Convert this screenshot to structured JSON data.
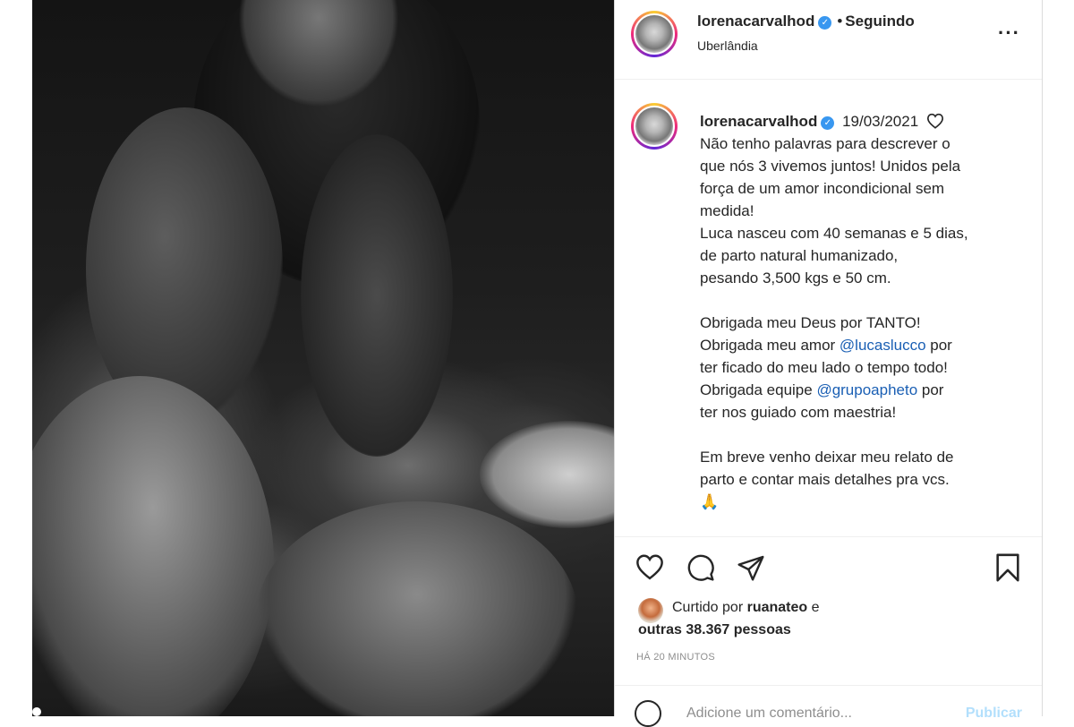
{
  "post": {
    "username": "lorenacarvalhod",
    "follow_status": "Seguindo",
    "location": "Uberlândia",
    "more_icon": "more-options-icon",
    "caption": {
      "username": "lorenacarvalhod",
      "date": "19/03/2021",
      "lines": [
        "Não tenho palavras para descrever o",
        "que nós 3 vivemos juntos! Unidos pela",
        "força de um amor incondicional sem",
        "medida!",
        "Luca nasceu com 40 semanas e 5 dias,",
        "de parto natural humanizado,",
        "pesando 3,500 kgs e 50 cm."
      ],
      "thanks1": "Obrigada meu Deus por TANTO!",
      "thanks2_pre": "Obrigada meu amor ",
      "mention1": "@lucaslucco",
      "thanks2_post": " por",
      "thanks3": "ter ficado do meu lado o tempo todo!",
      "thanks4_pre": "Obrigada equipe ",
      "mention2": "@grupoapheto",
      "thanks4_post": " por",
      "thanks5": "ter nos guiado com maestria!",
      "closing1": "Em breve venho deixar meu relato de",
      "closing2": "parto e contar mais detalhes pra vcs.",
      "emoji": "🙏"
    },
    "likes": {
      "prefix": "Curtido por ",
      "user": "ruanateo",
      "mid": " e",
      "others": "outras 38.367 pessoas"
    },
    "time_ago": "HÁ 20 MINUTOS",
    "comment_placeholder": "Adicione um comentário...",
    "publish_label": "Publicar"
  },
  "colors": {
    "link": "#1a5fb4",
    "verified": "#3897f0",
    "muted": "#8e8e8e"
  }
}
